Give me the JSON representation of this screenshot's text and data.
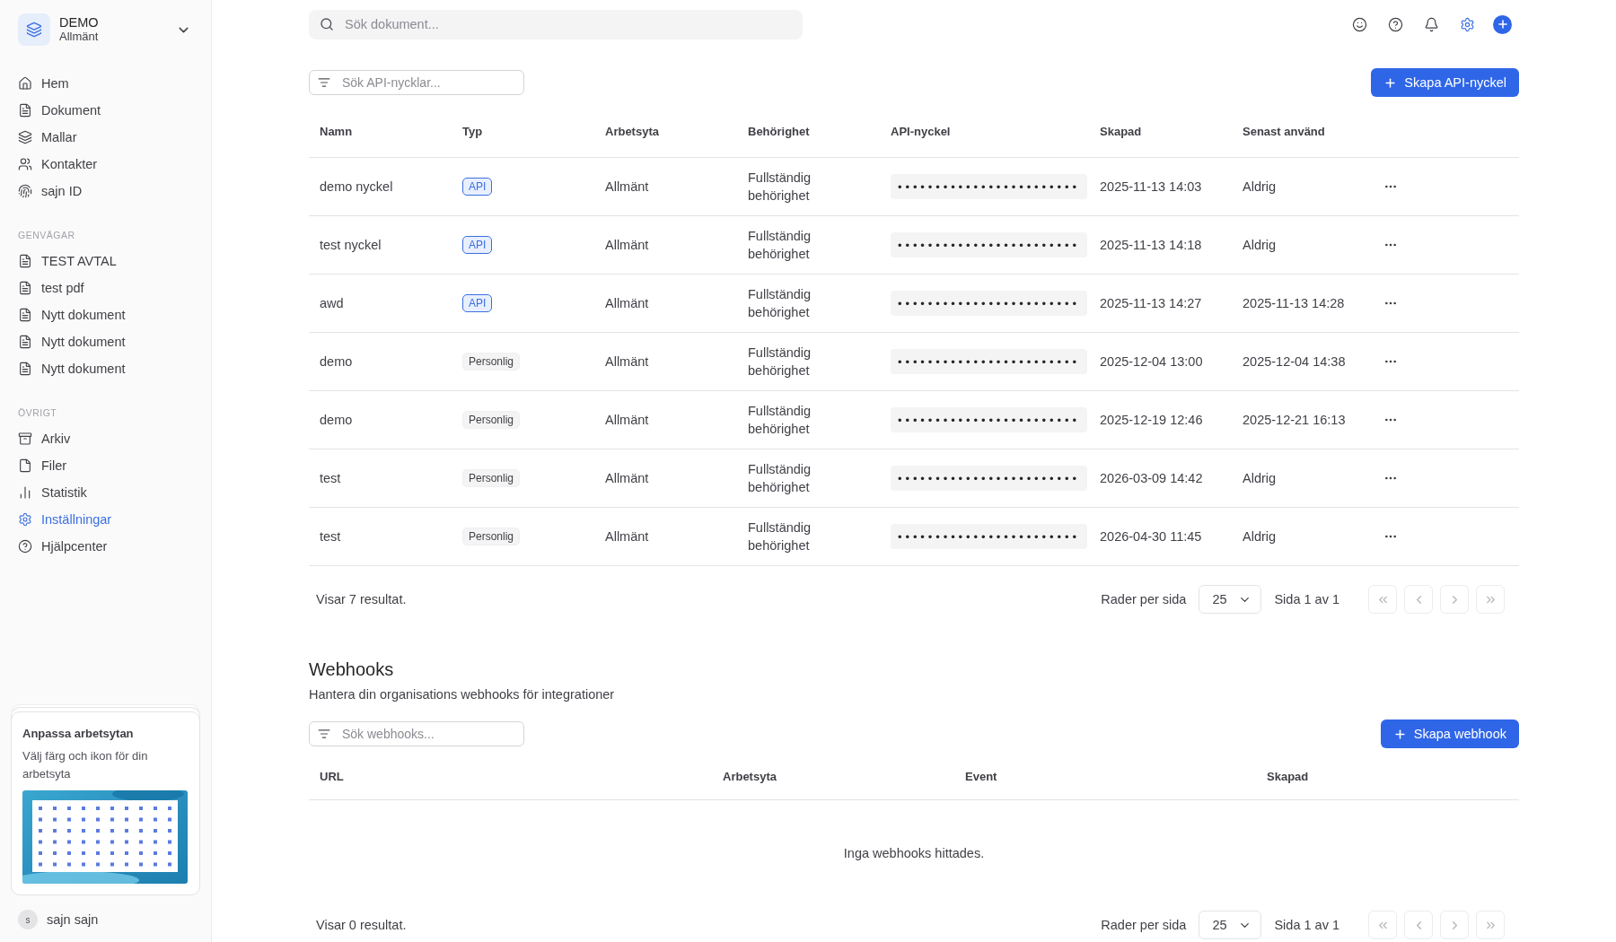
{
  "workspace": {
    "name": "DEMO",
    "subtitle": "Allmänt"
  },
  "main_nav": [
    {
      "label": "Hem",
      "selected": false
    },
    {
      "label": "Dokument",
      "selected": false
    },
    {
      "label": "Mallar",
      "selected": false
    },
    {
      "label": "Kontakter",
      "selected": false
    },
    {
      "label": "sajn ID",
      "selected": false
    }
  ],
  "shortcuts": {
    "title": "GENVÄGAR",
    "items": [
      {
        "label": "TEST AVTAL",
        "selected": false
      },
      {
        "label": "test pdf",
        "selected": false
      },
      {
        "label": "Nytt dokument",
        "selected": false
      },
      {
        "label": "Nytt dokument",
        "selected": false
      },
      {
        "label": "Nytt dokument",
        "selected": false
      }
    ]
  },
  "other": {
    "title": "ÖVRIGT",
    "items": [
      {
        "label": "Arkiv",
        "selected": false
      },
      {
        "label": "Filer",
        "selected": false
      },
      {
        "label": "Statistik",
        "selected": false
      },
      {
        "label": "Inställningar",
        "selected": true
      },
      {
        "label": "Hjälpcenter",
        "selected": false
      }
    ]
  },
  "promo_card": {
    "title": "Anpassa arbetsytan",
    "text": "Välj färg och ikon för din arbetsyta"
  },
  "user": {
    "initial": "s",
    "name": "sajn sajn"
  },
  "topbar": {
    "search": {
      "placeholder": "Sök dokument..."
    }
  },
  "api_keys": {
    "search": {
      "placeholder": "Sök API-nycklar..."
    },
    "create_button": "Skapa API-nyckel",
    "columns": [
      "Namn",
      "Typ",
      "Arbetsyta",
      "Behörighet",
      "API-nyckel",
      "Skapad",
      "Senast använd"
    ],
    "rows": [
      {
        "name": "demo nyckel",
        "type": {
          "label": "API",
          "kind": "api"
        },
        "workspace": "Allmänt",
        "permission": "Fullständig behörighet",
        "key": "••••••••••••••••••••••••",
        "created": "2025-11-13 14:03",
        "last_used": "Aldrig"
      },
      {
        "name": "test nyckel",
        "type": {
          "label": "API",
          "kind": "api"
        },
        "workspace": "Allmänt",
        "permission": "Fullständig behörighet",
        "key": "••••••••••••••••••••••••",
        "created": "2025-11-13 14:18",
        "last_used": "Aldrig"
      },
      {
        "name": "awd",
        "type": {
          "label": "API",
          "kind": "api"
        },
        "workspace": "Allmänt",
        "permission": "Fullständig behörighet",
        "key": "••••••••••••••••••••••••",
        "created": "2025-11-13 14:27",
        "last_used": "2025-11-13 14:28"
      },
      {
        "name": "demo",
        "type": {
          "label": "Personlig",
          "kind": "personal"
        },
        "workspace": "Allmänt",
        "permission": "Fullständig behörighet",
        "key": "••••••••••••••••••••••••",
        "created": "2025-12-04 13:00",
        "last_used": "2025-12-04 14:38"
      },
      {
        "name": "demo",
        "type": {
          "label": "Personlig",
          "kind": "personal"
        },
        "workspace": "Allmänt",
        "permission": "Fullständig behörighet",
        "key": "••••••••••••••••••••••••",
        "created": "2025-12-19 12:46",
        "last_used": "2025-12-21 16:13"
      },
      {
        "name": "test",
        "type": {
          "label": "Personlig",
          "kind": "personal"
        },
        "workspace": "Allmänt",
        "permission": "Fullständig behörighet",
        "key": "••••••••••••••••••••••••",
        "created": "2026-03-09 14:42",
        "last_used": "Aldrig"
      },
      {
        "name": "test",
        "type": {
          "label": "Personlig",
          "kind": "personal"
        },
        "workspace": "Allmänt",
        "permission": "Fullständig behörighet",
        "key": "••••••••••••••••••••••••",
        "created": "2026-04-30 11:45",
        "last_used": "Aldrig"
      }
    ],
    "footer": {
      "result": "Visar 7 resultat.",
      "rows_label": "Rader per sida",
      "page_size": "25",
      "page_info": "Sida 1 av 1",
      "nav_buttons": [
        {
          "disabled": true
        },
        {
          "disabled": true
        },
        {
          "disabled": true
        },
        {
          "disabled": true
        }
      ]
    }
  },
  "webhooks": {
    "title": "Webhooks",
    "subtitle": "Hantera din organisations webhooks för integrationer",
    "search": {
      "placeholder": "Sök webhooks..."
    },
    "create_button": "Skapa webhook",
    "columns": [
      "URL",
      "Arbetsyta",
      "Event",
      "Skapad"
    ],
    "empty": "Inga webhooks hittades.",
    "footer": {
      "result": "Visar 0 resultat.",
      "rows_label": "Rader per sida",
      "page_size": "25",
      "page_info": "Sida 1 av 1",
      "nav_buttons": [
        {
          "disabled": true
        },
        {
          "disabled": true
        },
        {
          "disabled": true
        },
        {
          "disabled": true
        }
      ]
    }
  }
}
